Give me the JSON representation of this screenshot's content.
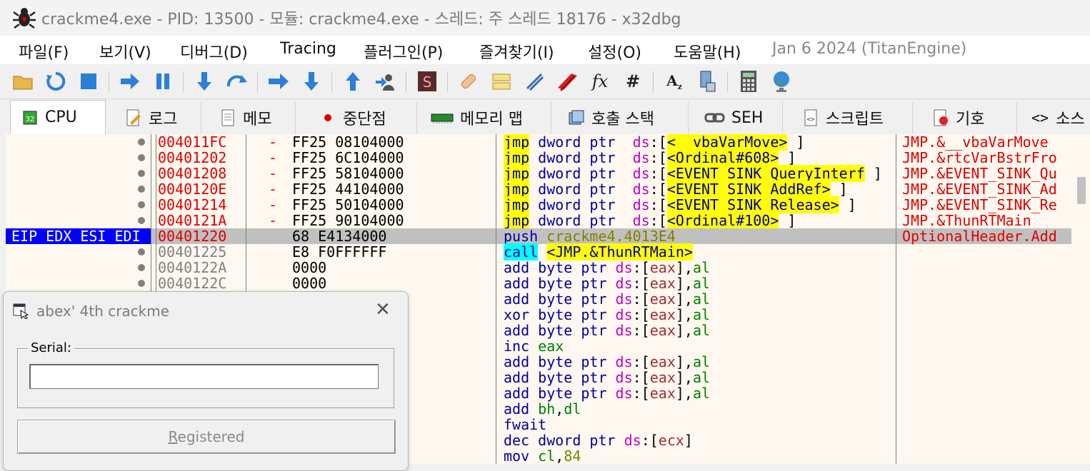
{
  "window": {
    "title": "crackme4.exe - PID: 13500 - 모듈: crackme4.exe - 스레드: 주 스레드 18176 - x32dbg"
  },
  "menu": {
    "items": [
      "파일(F)",
      "보기(V)",
      "디버그(D)",
      "Tracing",
      "플러그인(P)",
      "즐겨찾기(I)",
      "설정(O)",
      "도움말(H)"
    ],
    "version": "Jan 6 2024 (TitanEngine)"
  },
  "toolbar": {
    "buttons": [
      "open-icon",
      "restart-icon",
      "stop-icon",
      "run-icon",
      "pause-icon",
      "step-into-icon",
      "step-over-icon",
      "trace-into-icon",
      "trace-over-icon",
      "execute-till-return-icon",
      "run-to-user-code-icon",
      "scylla-icon",
      "patch-icon",
      "comment-icon",
      "label-icon",
      "bookmark-icon",
      "function-icon",
      "hash-icon",
      "font-icon",
      "device-icon",
      "calculator-icon",
      "globe-icon"
    ]
  },
  "tabs": [
    "CPU",
    "로그",
    "메모",
    "중단점",
    "메모리 맵",
    "호출 스택",
    "SEH",
    "스크립트",
    "기호",
    "소스"
  ],
  "disasm": {
    "eip_label": "EIP EDX ESI EDI",
    "rows": [
      {
        "addr": "004011FC",
        "arrow": "-",
        "bytes": "FF25 08104000",
        "mn": "jmp",
        "op": "dword ptr",
        "seg": "ds",
        "ref": "<__vbaVarMove>",
        "cmt": "JMP.&__vbaVarMove"
      },
      {
        "addr": "00401202",
        "arrow": "-",
        "bytes": "FF25 6C104000",
        "mn": "jmp",
        "op": "dword ptr",
        "seg": "ds",
        "ref": "<Ordinal#608>",
        "cmt": "JMP.&rtcVarBstrFro"
      },
      {
        "addr": "00401208",
        "arrow": "-",
        "bytes": "FF25 58104000",
        "mn": "jmp",
        "op": "dword ptr",
        "seg": "ds",
        "ref": "<EVENT_SINK_QueryInterf",
        "cmt": "JMP.&EVENT_SINK_Qu"
      },
      {
        "addr": "0040120E",
        "arrow": "-",
        "bytes": "FF25 44104000",
        "mn": "jmp",
        "op": "dword ptr",
        "seg": "ds",
        "ref": "<EVENT_SINK_AddRef>",
        "cmt": "JMP.&EVENT_SINK_Ad"
      },
      {
        "addr": "00401214",
        "arrow": "-",
        "bytes": "FF25 50104000",
        "mn": "jmp",
        "op": "dword ptr",
        "seg": "ds",
        "ref": "<EVENT_SINK_Release>",
        "cmt": "JMP.&EVENT_SINK_Re"
      },
      {
        "addr": "0040121A",
        "arrow": "-",
        "bytes": "FF25 90104000",
        "mn": "jmp",
        "op": "dword ptr",
        "seg": "ds",
        "ref": "<Ordinal#100>",
        "cmt": "JMP.&ThunRTMain"
      },
      {
        "addr": "00401220",
        "bytes": "68 E4134000",
        "mn": "push",
        "arg": "crackme4.4013E4",
        "cmt": "OptionalHeader.Add"
      },
      {
        "addr": "00401225",
        "bytes": "E8 F0FFFFFF",
        "mn": "call",
        "arg": "<JMP.&ThunRTMain>"
      },
      {
        "addr": "0040122A",
        "bytes": "0000",
        "text": "add byte ptr ds:[eax],al"
      },
      {
        "addr": "0040122C",
        "bytes": "0000",
        "text": "add byte ptr ds:[eax],al"
      },
      {
        "text": "add byte ptr ds:[eax],al"
      },
      {
        "text": "xor byte ptr ds:[eax],al"
      },
      {
        "text": "add byte ptr ds:[eax],al"
      },
      {
        "text": "inc eax"
      },
      {
        "text": "add byte ptr ds:[eax],al"
      },
      {
        "text": "add byte ptr ds:[eax],al"
      },
      {
        "text": "add byte ptr ds:[eax],al"
      },
      {
        "text": "add bh,dl"
      },
      {
        "text": "fwait"
      },
      {
        "text": "dec dword ptr ds:[ecx]"
      },
      {
        "text": "mov cl,84"
      }
    ]
  },
  "dialog": {
    "title": "abex' 4th crackme",
    "group_label": "Serial:",
    "serial_value": "",
    "button_label": "Registered"
  }
}
